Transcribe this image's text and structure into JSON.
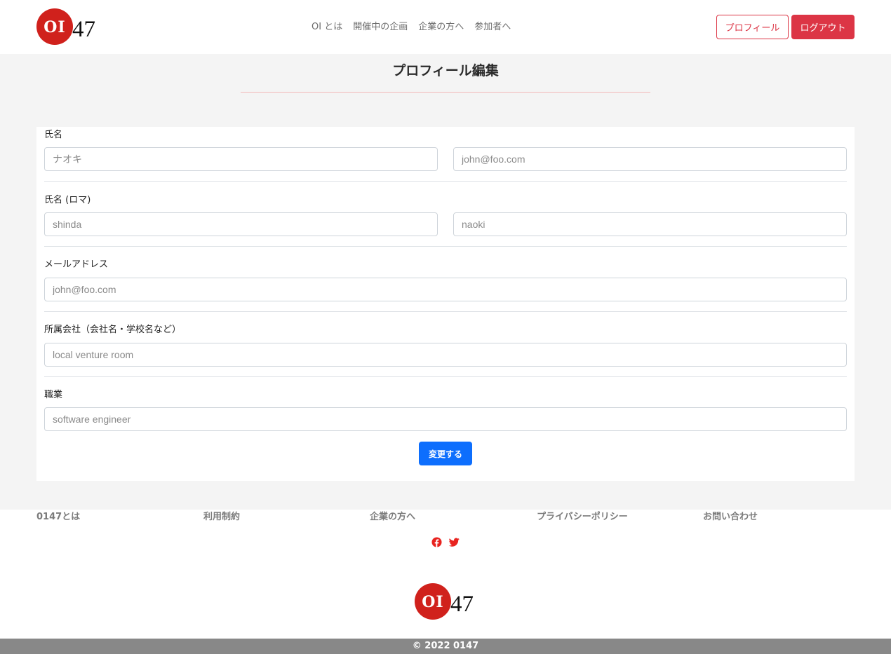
{
  "brand": {
    "logo_mark": "OI",
    "logo_number": "47",
    "accent_color": "#d0211c"
  },
  "nav": {
    "items": [
      {
        "label": "OI とは"
      },
      {
        "label": "開催中の企画"
      },
      {
        "label": "企業の方へ"
      },
      {
        "label": "参加者へ"
      }
    ],
    "profile_button": "プロフィール",
    "logout_button": "ログアウト"
  },
  "page": {
    "title": "プロフィール編集"
  },
  "form": {
    "name": {
      "label": "氏名",
      "last_placeholder": "ナオキ",
      "first_placeholder": "john@foo.com"
    },
    "name_roman": {
      "label": "氏名 (ロマ)",
      "last_placeholder": "shinda",
      "first_placeholder": "naoki"
    },
    "email": {
      "label": "メールアドレス",
      "placeholder": "john@foo.com"
    },
    "company": {
      "label": "所属会社（会社名・学校名など）",
      "placeholder": "local venture room"
    },
    "occupation": {
      "label": "職業",
      "placeholder": "software engineer"
    },
    "submit_label": "変更する",
    "submit_color": "#0d6efd"
  },
  "footer": {
    "links": [
      {
        "label": "0147とは"
      },
      {
        "label": "利用制約"
      },
      {
        "label": "企業の方へ"
      },
      {
        "label": "プライバシーポリシー"
      },
      {
        "label": "お問い合わせ"
      }
    ],
    "social_icons": [
      "facebook-icon",
      "twitter-icon"
    ],
    "social_color": "#e8231f",
    "copyright": "© 2022 0147"
  }
}
